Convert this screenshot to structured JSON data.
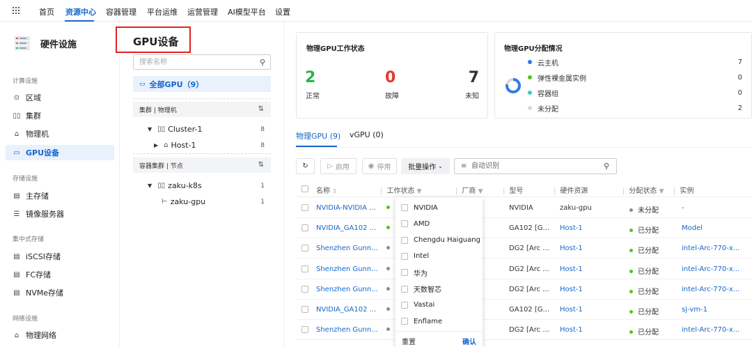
{
  "topnav": {
    "items": [
      "首页",
      "资源中心",
      "容器管理",
      "平台运维",
      "运营管理",
      "AI模型平台",
      "设置"
    ],
    "active_index": 1
  },
  "sidebar": {
    "title": "硬件设施",
    "sections": [
      {
        "label": "计算设施",
        "items": [
          {
            "label": "区域",
            "icon": "location-icon"
          },
          {
            "label": "集群",
            "icon": "cluster-icon"
          },
          {
            "label": "物理机",
            "icon": "host-icon"
          },
          {
            "label": "GPU设备",
            "icon": "gpu-icon",
            "active": true
          }
        ]
      },
      {
        "label": "存储设施",
        "items": [
          {
            "label": "主存储",
            "icon": "storage-icon"
          },
          {
            "label": "镜像服务器",
            "icon": "image-server-icon"
          }
        ]
      },
      {
        "label": "集中式存储",
        "items": [
          {
            "label": "iSCSI存储",
            "icon": "storage-icon"
          },
          {
            "label": "FC存储",
            "icon": "storage-icon"
          },
          {
            "label": "NVMe存储",
            "icon": "storage-icon"
          }
        ]
      },
      {
        "label": "网络设施",
        "items": [
          {
            "label": "物理网络",
            "icon": "network-icon"
          }
        ]
      }
    ]
  },
  "tree": {
    "title": "GPU设备",
    "search_placeholder": "搜索名称",
    "all_label": "全部GPU（9）",
    "group1_header": "集群 | 物理机",
    "cluster_name": "Cluster-1",
    "cluster_count": "8",
    "host_name": "Host-1",
    "host_count": "8",
    "group2_header": "容器集群 | 节点",
    "k8s_name": "zaku-k8s",
    "k8s_count": "1",
    "node_name": "zaku-gpu",
    "node_count": "1"
  },
  "status_card": {
    "title": "物理GPU工作状态",
    "stats": [
      {
        "value": "2",
        "label": "正常",
        "color": "#2bb24c"
      },
      {
        "value": "0",
        "label": "故障",
        "color": "#e8382f"
      },
      {
        "value": "7",
        "label": "未知",
        "color": "#333333"
      }
    ]
  },
  "alloc_card": {
    "title": "物理GPU分配情况",
    "rows": [
      {
        "label": "云主机",
        "value": "7",
        "color": "#2f7be5"
      },
      {
        "label": "弹性裸金属实例",
        "value": "0",
        "color": "#52c41a"
      },
      {
        "label": "容器组",
        "value": "0",
        "color": "#36cfc9"
      },
      {
        "label": "未分配",
        "value": "2",
        "color": "#d9d9d9"
      }
    ]
  },
  "tabs": [
    "物理GPU (9)",
    "vGPU (0)"
  ],
  "toolbar": {
    "enable": "启用",
    "disable": "停用",
    "batch": "批量操作",
    "filter_placeholder": "自动识别"
  },
  "table": {
    "headers": [
      "名称",
      "工作状态",
      "厂商",
      "型号",
      "硬件资源",
      "分配状态",
      "实例"
    ],
    "rows": [
      {
        "name": "NVIDIA-NVIDIA ...",
        "status_color": "#52c41a",
        "model": "NVIDIA",
        "hw": "zaku-gpu",
        "hw_link": false,
        "alloc": "未分配",
        "alloc_color": "#8c8c8c",
        "instance": "-",
        "inst_link": false
      },
      {
        "name": "NVIDIA_GA102 ...",
        "status_color": "#52c41a",
        "model": "GA102 [G...",
        "hw": "Host-1",
        "hw_link": true,
        "alloc": "已分配",
        "alloc_color": "#52c41a",
        "instance": "Model",
        "inst_link": true
      },
      {
        "name": "Shenzhen Gunn...",
        "status_color": "#8c8c8c",
        "model": "DG2 [Arc ...",
        "hw": "Host-1",
        "hw_link": true,
        "alloc": "已分配",
        "alloc_color": "#52c41a",
        "instance": "intel-Arc-770-x...",
        "inst_link": true
      },
      {
        "name": "Shenzhen Gunn...",
        "status_color": "#8c8c8c",
        "model": "DG2 [Arc ...",
        "hw": "Host-1",
        "hw_link": true,
        "alloc": "已分配",
        "alloc_color": "#52c41a",
        "instance": "intel-Arc-770-x...",
        "inst_link": true
      },
      {
        "name": "Shenzhen Gunn...",
        "status_color": "#8c8c8c",
        "model": "DG2 [Arc ...",
        "hw": "Host-1",
        "hw_link": true,
        "alloc": "已分配",
        "alloc_color": "#52c41a",
        "instance": "intel-Arc-770-x...",
        "inst_link": true
      },
      {
        "name": "NVIDIA_GA102 ...",
        "status_color": "#8c8c8c",
        "model": "GA102 [G...",
        "hw": "Host-1",
        "hw_link": true,
        "alloc": "已分配",
        "alloc_color": "#52c41a",
        "instance": "sj-vm-1",
        "inst_link": true
      },
      {
        "name": "Shenzhen Gunn...",
        "status_color": "#8c8c8c",
        "model": "DG2 [Arc ...",
        "hw": "Host-1",
        "hw_link": true,
        "alloc": "已分配",
        "alloc_color": "#52c41a",
        "instance": "intel-Arc-770-x...",
        "inst_link": true
      }
    ]
  },
  "vendor_filter": {
    "options": [
      "NVIDIA",
      "AMD",
      "Chengdu Haiguang",
      "Intel",
      "华为",
      "天数智芯",
      "Vastai",
      "Enflame"
    ],
    "reset": "重置",
    "confirm": "确认"
  }
}
